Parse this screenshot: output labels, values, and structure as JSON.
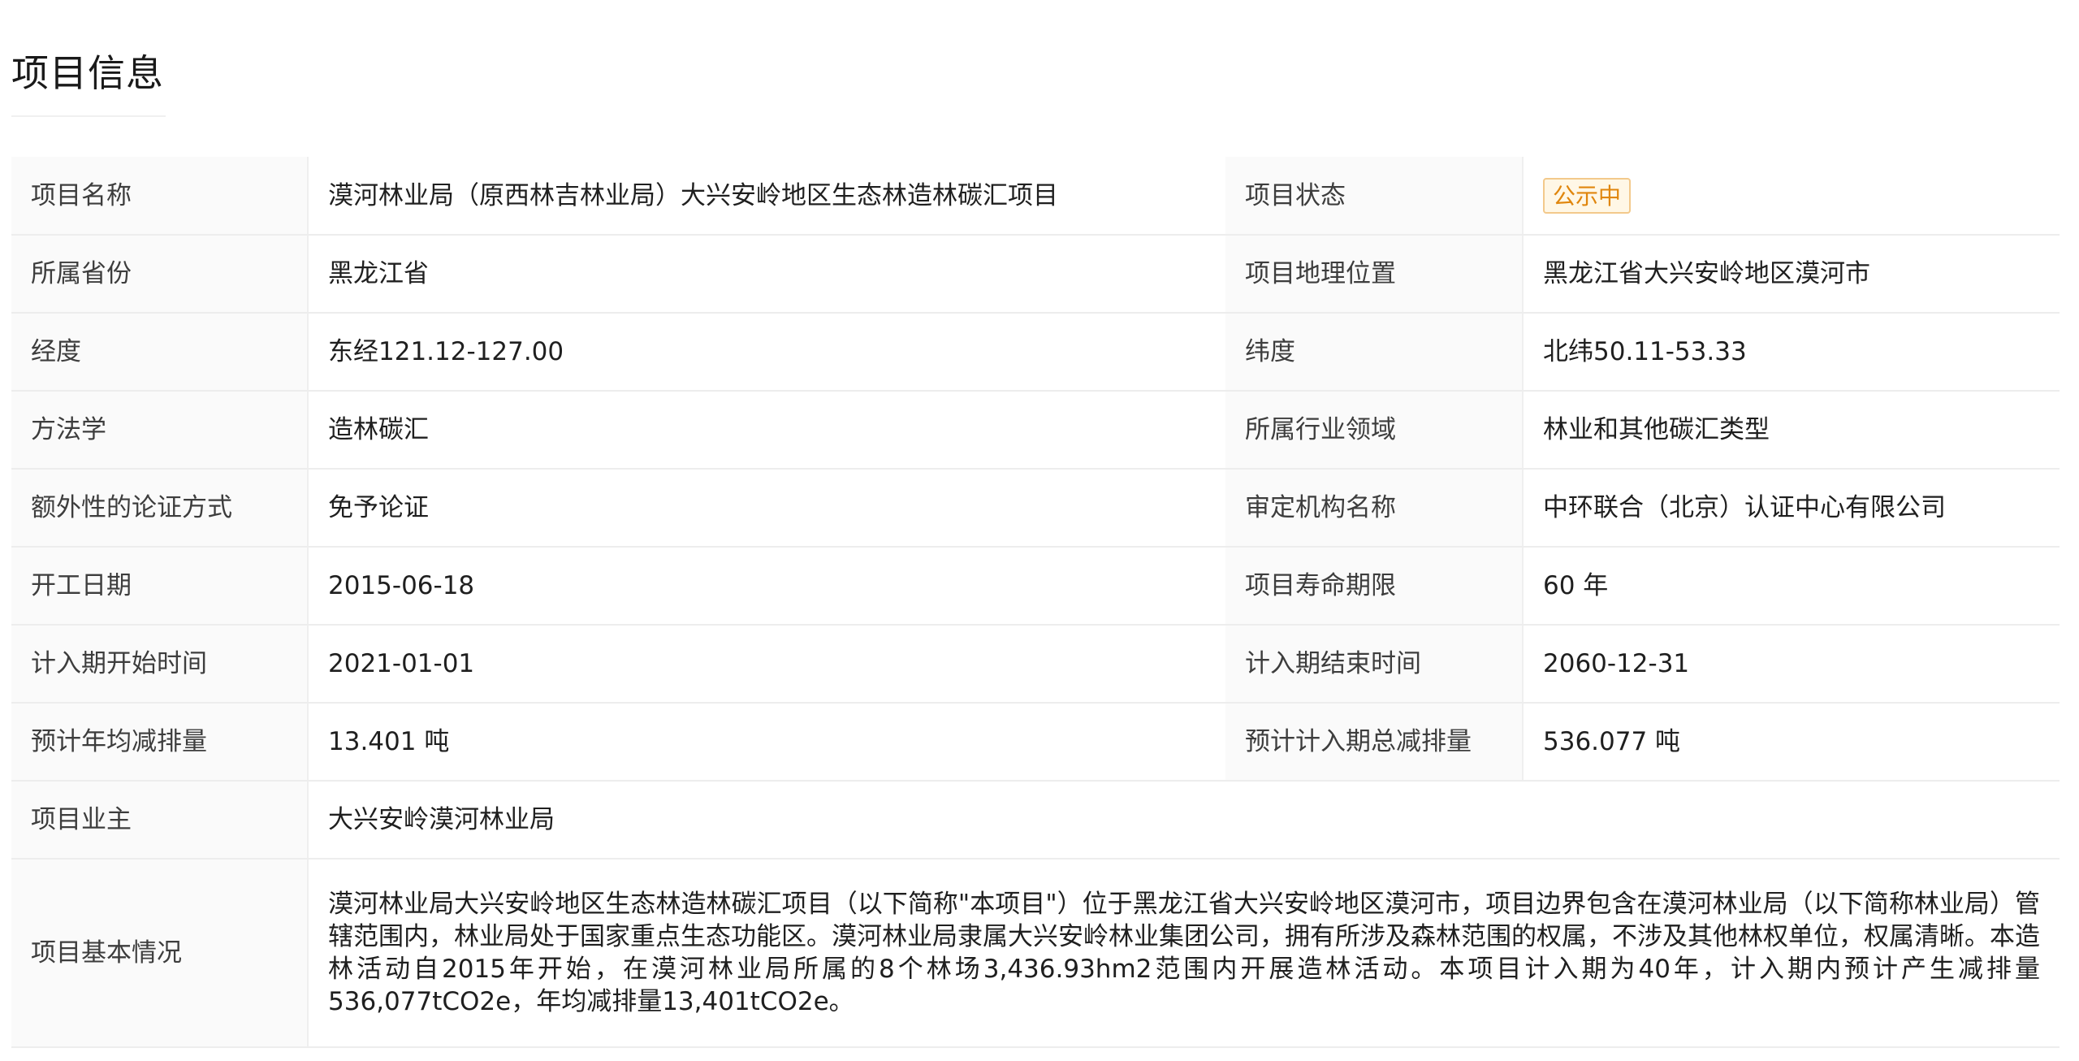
{
  "section": {
    "title": "项目信息"
  },
  "status": {
    "badge_label": "公示中",
    "badge_color": "#e0860d",
    "badge_border": "#f3c98b",
    "badge_bg": "#fff7e6"
  },
  "rows": [
    {
      "l1": "项目名称",
      "v1": "漠河林业局（原西林吉林业局）大兴安岭地区生态林造林碳汇项目",
      "l2": "项目状态"
    },
    {
      "l1": "所属省份",
      "v1": "黑龙江省",
      "l2": "项目地理位置",
      "v2": "黑龙江省大兴安岭地区漠河市"
    },
    {
      "l1": "经度",
      "v1": "东经121.12-127.00",
      "l2": "纬度",
      "v2": "北纬50.11-53.33"
    },
    {
      "l1": "方法学",
      "v1": "造林碳汇",
      "l2": "所属行业领域",
      "v2": "林业和其他碳汇类型"
    },
    {
      "l1": "额外性的论证方式",
      "v1": "免予论证",
      "l2": "审定机构名称",
      "v2": "中环联合（北京）认证中心有限公司"
    },
    {
      "l1": "开工日期",
      "v1": "2015-06-18",
      "l2": "项目寿命期限",
      "v2": "60 年"
    },
    {
      "l1": "计入期开始时间",
      "v1": "2021-01-01",
      "l2": "计入期结束时间",
      "v2": "2060-12-31"
    },
    {
      "l1": "预计年均减排量",
      "v1": "13.401 吨",
      "l2": "预计计入期总减排量",
      "v2": "536.077 吨"
    }
  ],
  "owner": {
    "label": "项目业主",
    "value": "大兴安岭漠河林业局"
  },
  "overview": {
    "label": "项目基本情况",
    "value": "漠河林业局大兴安岭地区生态林造林碳汇项目（以下简称\"本项目\"）位于黑龙江省大兴安岭地区漠河市，项目边界包含在漠河林业局（以下简称林业局）管辖范围内，林业局处于国家重点生态功能区。漠河林业局隶属大兴安岭林业集团公司，拥有所涉及森林范围的权属，不涉及其他林权单位，权属清晰。本造林活动自2015年开始，在漠河林业局所属的8个林场3,436.93hm2范围内开展造林活动。本项目计入期为40年，计入期内预计产生减排量536,077tCO2e，年均减排量13,401tCO2e。"
  }
}
